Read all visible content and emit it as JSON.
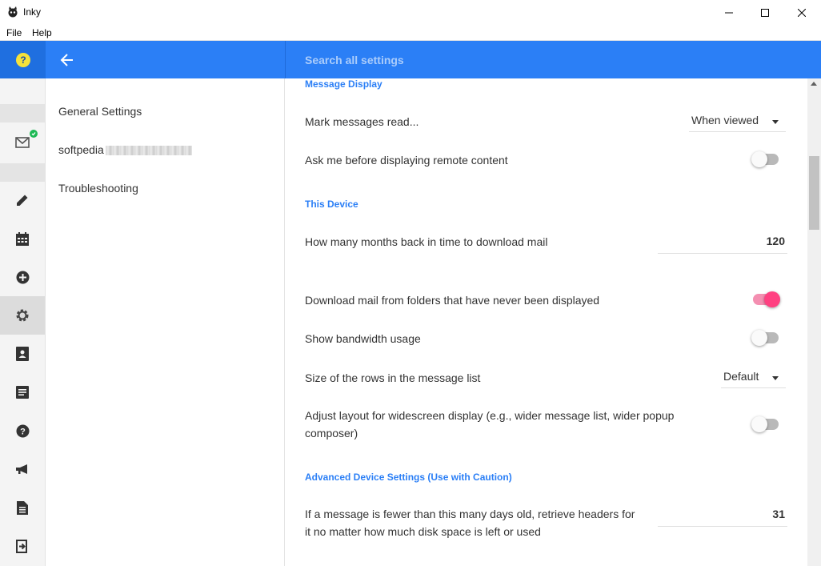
{
  "window": {
    "title": "Inky",
    "icon": "inky-cat-icon"
  },
  "menu": {
    "file": "File",
    "help": "Help"
  },
  "header": {
    "help_badge": "?",
    "search_placeholder": "Search all settings",
    "accent_color": "#2b7ff6"
  },
  "rail": {
    "items": [
      "mail-icon",
      "pencil-icon",
      "calendar-icon",
      "add-circle-icon",
      "gear-icon",
      "contacts-icon",
      "notes-icon",
      "help-icon",
      "megaphone-icon",
      "document-icon",
      "logout-icon"
    ],
    "active": "gear-icon"
  },
  "nav": {
    "general": "General Settings",
    "account": "softpedia",
    "troubleshooting": "Troubleshooting"
  },
  "sections": {
    "message_display": "Message Display",
    "this_device": "This Device",
    "advanced": "Advanced Device Settings (Use with Caution)"
  },
  "settings": {
    "mark_read": {
      "label": "Mark messages read...",
      "value": "When viewed"
    },
    "remote_content": {
      "label": "Ask me before displaying remote content",
      "on": false
    },
    "months_back": {
      "label": "How many months back in time to download mail",
      "value": "120"
    },
    "download_folders": {
      "label": "Download mail from folders that have never been displayed",
      "on": true
    },
    "bandwidth": {
      "label": "Show bandwidth usage",
      "on": false
    },
    "row_size": {
      "label": "Size of the rows in the message list",
      "value": "Default"
    },
    "widescreen": {
      "label_line1": "Adjust layout for widescreen display (e.g., wider message list, wider popup",
      "label_line2": "composer)",
      "on": false
    },
    "days_old": {
      "label_line1": "If a message is fewer than this many days old, retrieve headers for",
      "label_line2": "it no matter how much disk space is left or used",
      "value": "31"
    }
  }
}
